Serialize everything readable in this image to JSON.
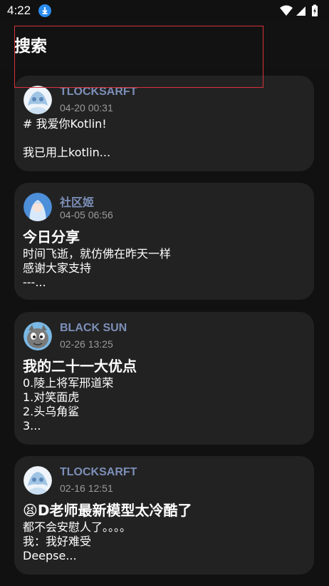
{
  "status_bar": {
    "time": "4:22",
    "icons": [
      "download-icon",
      "wifi-icon",
      "signal-icon",
      "battery-charging-icon"
    ]
  },
  "header": {
    "title": "搜索"
  },
  "colors": {
    "background": "#111111",
    "card": "#222222",
    "author": "#7c8fb8",
    "time": "#9a9a9a",
    "highlight": "#d8323a"
  },
  "posts": [
    {
      "author": "TLOCKSARFT",
      "time": "04-20 00:31",
      "title": "",
      "preview": "# 我爱你Kotlin!\n\n我已用上kotlin..."
    },
    {
      "author": "社区姬",
      "time": "04-05 06:56",
      "title": "今日分享",
      "preview": "时间飞逝，就仿佛在昨天一样\n感谢大家支持\n---..."
    },
    {
      "author": "BLACK SUN",
      "time": "02-26 13:25",
      "title": "我的二十一大优点",
      "preview": "0.陵上将军邢道荣\n1.对笑面虎\n2.头乌角鲨\n3..."
    },
    {
      "author": "TLOCKSARFT",
      "time": "02-16 12:51",
      "title": "😫D老师最新模型太冷酷了",
      "preview": "都不会安慰人了。。。。\n我：我好难受\nDeepse..."
    }
  ]
}
